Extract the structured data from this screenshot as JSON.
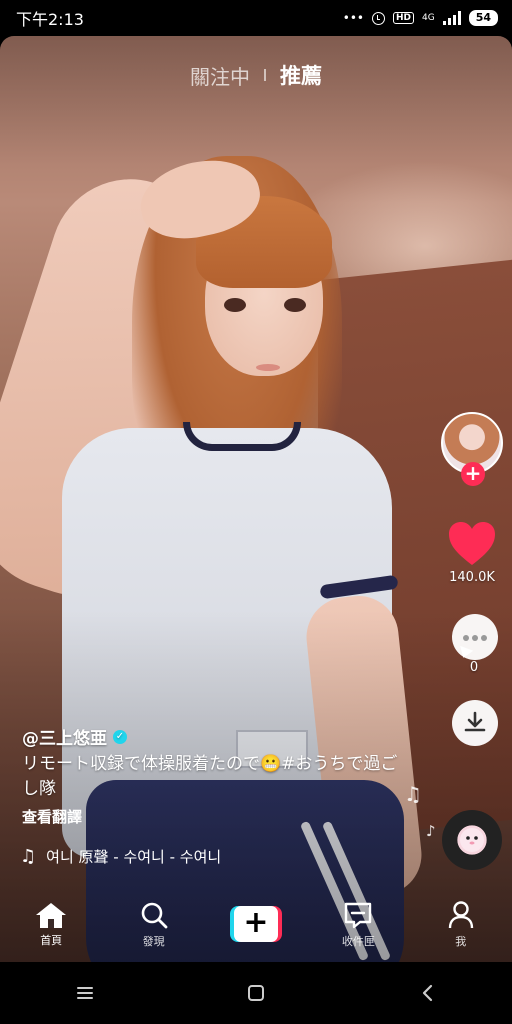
{
  "status_bar": {
    "time": "下午2:13",
    "more_icon": "more-dots-icon",
    "alarm_icon": "alarm-clock-icon",
    "hd_label": "HD",
    "network": "4G",
    "battery": "54"
  },
  "top_tabs": {
    "following": "關注中",
    "recommended": "推薦"
  },
  "actions": {
    "follow_icon": "plus-icon",
    "like_icon": "heart-icon",
    "like_count": "140.0K",
    "comment_icon": "comment-icon",
    "comment_count": "0",
    "download_icon": "download-icon",
    "music_disc_icon": "music-disc-icon"
  },
  "post": {
    "username": "@三上悠亜",
    "caption": "リモート収録で体操服着たので😬#おうちで過ごし隊",
    "translate": "查看翻譯",
    "music": "여니    原聲 - 수여니 - 수여니"
  },
  "colors": {
    "like_red": "#fe2c55",
    "accent_cyan": "#20d5ec"
  },
  "bottom_nav": [
    {
      "label": "首頁",
      "icon": "home-icon"
    },
    {
      "label": "發現",
      "icon": "search-icon"
    },
    {
      "label": "",
      "icon": "create-plus-icon"
    },
    {
      "label": "收件匣",
      "icon": "inbox-icon"
    },
    {
      "label": "我",
      "icon": "profile-icon"
    }
  ]
}
